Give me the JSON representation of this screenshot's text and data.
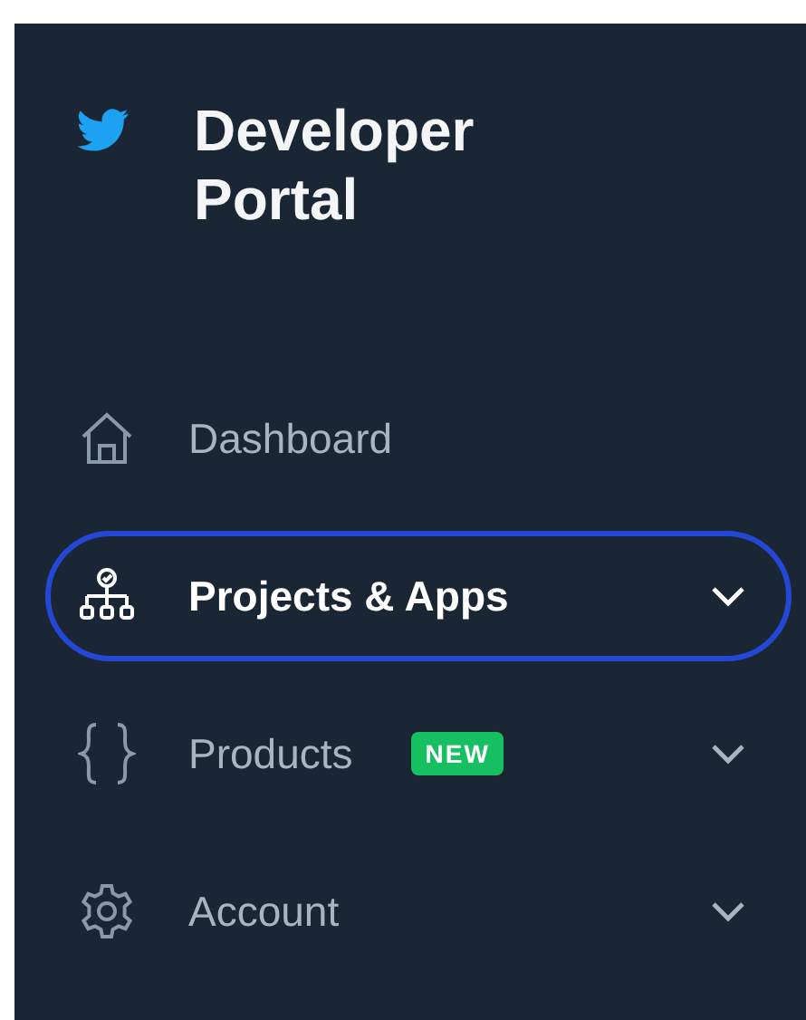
{
  "header": {
    "title": "Developer Portal"
  },
  "nav": [
    {
      "label": "Dashboard",
      "selected": false,
      "expandable": false
    },
    {
      "label": "Projects & Apps",
      "selected": true,
      "expandable": true
    },
    {
      "label": "Products",
      "selected": false,
      "expandable": true,
      "badge": "NEW"
    },
    {
      "label": "Account",
      "selected": false,
      "expandable": true
    }
  ]
}
